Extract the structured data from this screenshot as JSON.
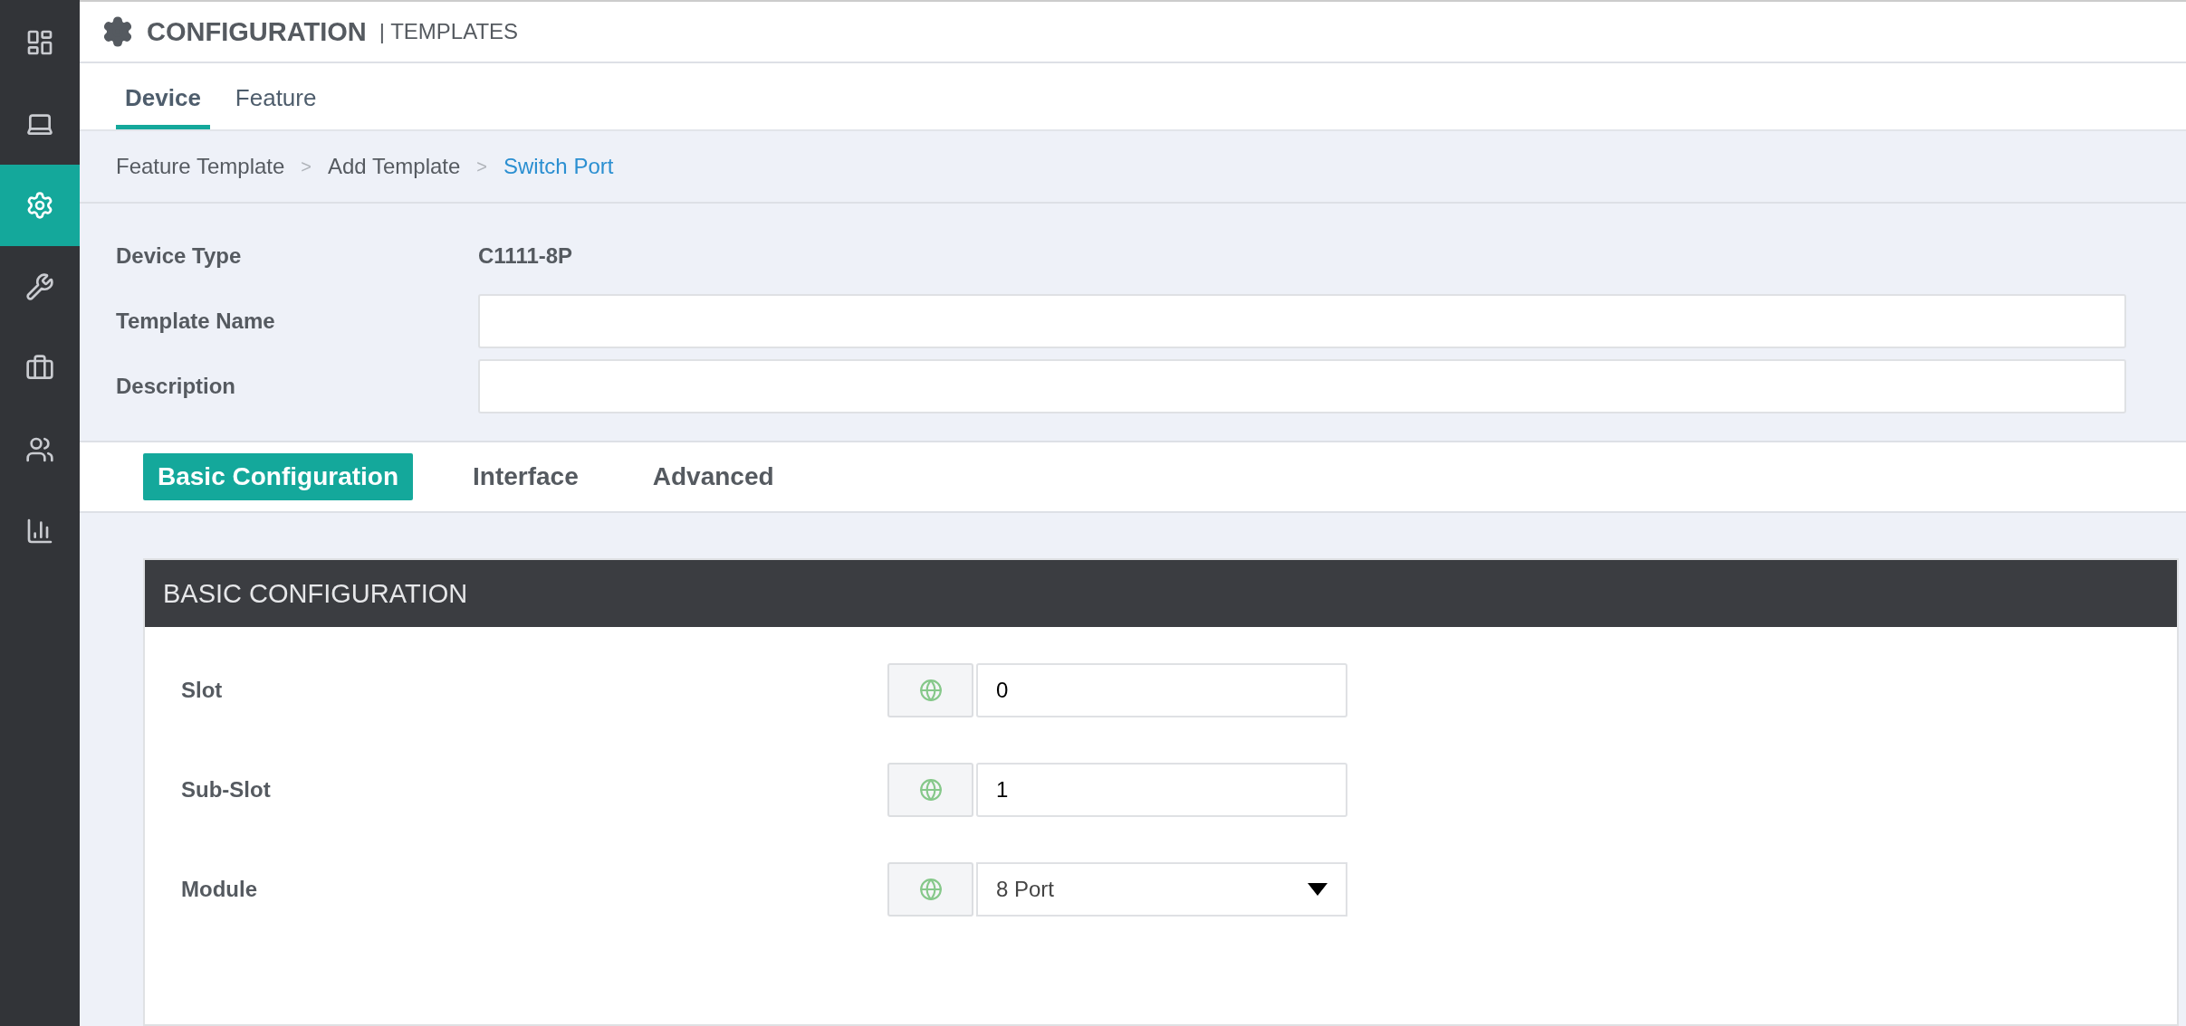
{
  "sidebar": {
    "items": [
      {
        "kind": "dashboard",
        "selected": false
      },
      {
        "kind": "laptop",
        "selected": false
      },
      {
        "kind": "gear",
        "selected": true
      },
      {
        "kind": "wrench",
        "selected": false
      },
      {
        "kind": "briefcase",
        "selected": false
      },
      {
        "kind": "users",
        "selected": false
      },
      {
        "kind": "chart",
        "selected": false
      }
    ]
  },
  "header": {
    "title": "CONFIGURATION",
    "separator": "|",
    "subtitle": "TEMPLATES"
  },
  "tabs": [
    {
      "label": "Device",
      "selected": true
    },
    {
      "label": "Feature",
      "selected": false
    }
  ],
  "breadcrumb": [
    {
      "label": "Feature Template",
      "current": false
    },
    {
      "label": "Add Template",
      "current": false
    },
    {
      "label": "Switch Port",
      "current": true
    }
  ],
  "breadcrumb_separator": ">",
  "form": {
    "device_type": {
      "label": "Device Type",
      "value": "C1111-8P"
    },
    "fields": [
      {
        "label": "Template Name"
      },
      {
        "label": "Description"
      }
    ]
  },
  "config_tabs": [
    {
      "label": "Basic Configuration",
      "selected": true
    },
    {
      "label": "Interface",
      "selected": false
    },
    {
      "label": "Advanced",
      "selected": false
    }
  ],
  "panel": {
    "title": "BASIC CONFIGURATION",
    "rows": [
      {
        "label": "Slot",
        "kind": "input",
        "value": "0"
      },
      {
        "label": "Sub-Slot",
        "kind": "input",
        "value": "1"
      },
      {
        "label": "Module",
        "kind": "select",
        "value": "8 Port"
      }
    ]
  }
}
